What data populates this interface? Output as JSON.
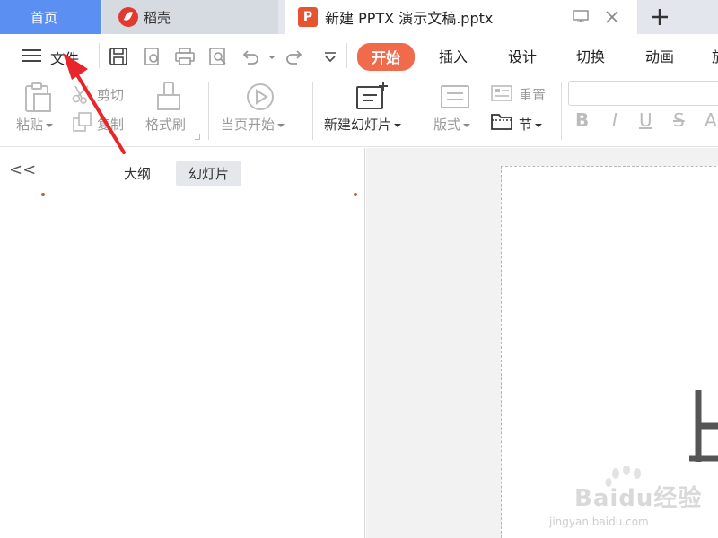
{
  "tabs": {
    "home": "首页",
    "daoke": "稻壳",
    "document": "新建 PPTX 演示文稿.pptx",
    "doc_icon_letter": "P"
  },
  "menu": {
    "file": "文件",
    "tabs": [
      "开始",
      "插入",
      "设计",
      "切换",
      "动画",
      "放"
    ],
    "active_tab": "开始"
  },
  "ribbon": {
    "paste": "粘贴",
    "cut": "剪切",
    "copy": "复制",
    "format_painter": "格式刷",
    "from_current": "当页开始",
    "new_slide": "新建幻灯片",
    "layout": "版式",
    "reset": "重置",
    "section": "节",
    "bold": "B",
    "italic": "I",
    "underline": "U",
    "strike": "S",
    "font_color": "A"
  },
  "left_pane": {
    "collapse": "<<",
    "outline_tab": "大纲",
    "slides_tab": "幻灯片",
    "active_tab": "幻灯片"
  },
  "watermark": {
    "text": "Baidu经验",
    "sub": "jingyan.baidu.com"
  },
  "colors": {
    "home_tab": "#5b8ff2",
    "active_menu": "#ef6b4b",
    "arrow": "#e8262a",
    "ppt_brand": "#e8532f"
  },
  "icons": [
    "hamburger-icon",
    "save-icon",
    "export-icon",
    "print-icon",
    "preview-icon",
    "undo-icon",
    "redo-icon",
    "more-icon",
    "paste-icon",
    "cut-icon",
    "copy-icon",
    "format-painter-icon",
    "play-icon",
    "new-slide-icon",
    "layout-icon",
    "reset-icon",
    "section-icon",
    "monitor-icon",
    "close-icon",
    "plus-icon"
  ]
}
